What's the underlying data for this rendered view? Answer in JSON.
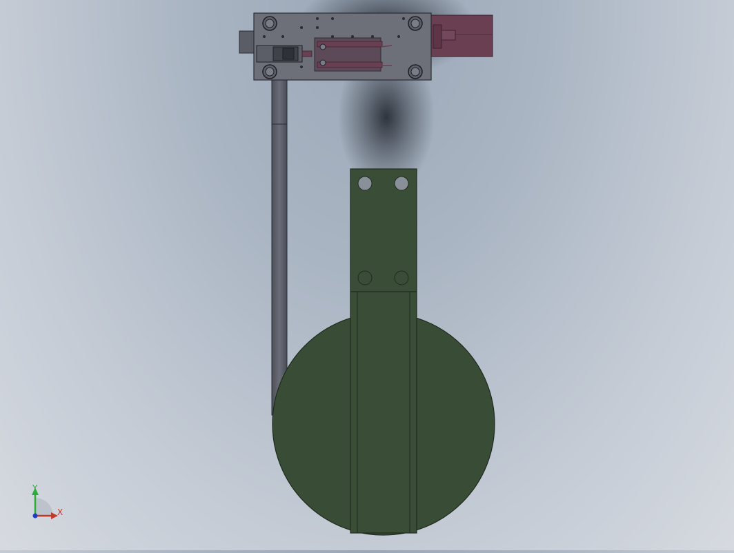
{
  "viewport": {
    "background": "#a9b4c2",
    "shadow_color": "#1b1f26"
  },
  "model": {
    "colors": {
      "plate": "#6d6f79",
      "plate_edge": "#2b2c33",
      "rod": "#5e616b",
      "cylinder": "#6b3f52",
      "cylinder_dark": "#4d2c3b",
      "disc": "#394d36",
      "disc_edge": "#1f2a1d",
      "bracket": "#3a4e37",
      "hole": "#8a9099"
    }
  },
  "triad": {
    "x_label": "X",
    "y_label": "Y",
    "x_color": "#c0392b",
    "y_color": "#2eab3b",
    "z_color": "#1f3fbf"
  }
}
